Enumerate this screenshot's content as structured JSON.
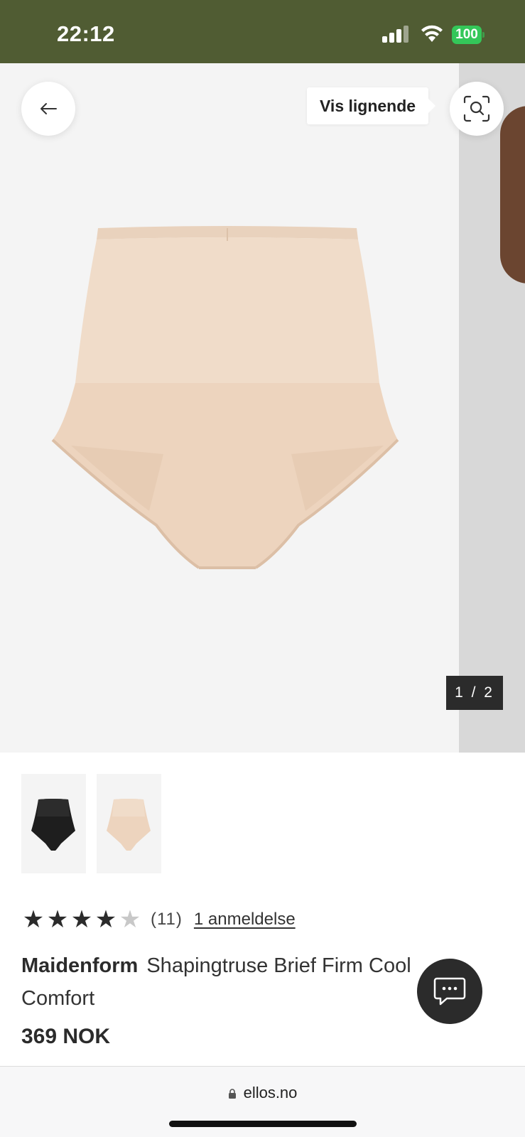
{
  "status_bar": {
    "time": "22:12",
    "battery": "100",
    "background_color": "#505c33",
    "battery_color": "#34c759"
  },
  "gallery": {
    "tooltip": "Vis lignende",
    "counter": "1 / 2",
    "icons": {
      "back": "arrow-left-icon",
      "visual_search": "visual-search-icon"
    },
    "background_color": "#f4f4f4"
  },
  "thumbnails": [
    {
      "color": "black",
      "selected": false
    },
    {
      "color": "beige",
      "selected": true
    }
  ],
  "rating": {
    "stars": 4,
    "max_stars": 5,
    "count": "(11)",
    "reviews_link": "1 anmeldelse"
  },
  "product": {
    "brand": "Maidenform",
    "name": "Shapingtruse Brief Firm Cool Comfort",
    "price": "369 NOK"
  },
  "chat": {
    "icon": "chat-bubble-icon"
  },
  "browser": {
    "url": "ellos.no",
    "icon": "lock-icon"
  }
}
